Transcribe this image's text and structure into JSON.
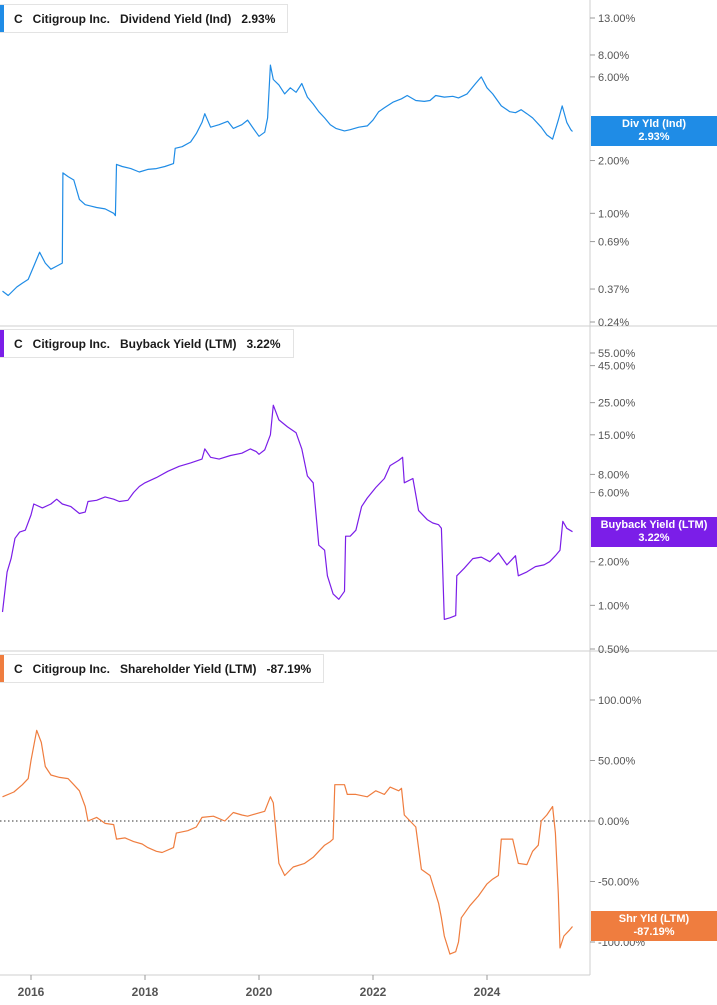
{
  "chart_data": [
    {
      "type": "line",
      "ticker": "C",
      "company": "Citigroup Inc.",
      "metric": "Dividend Yield (Ind)",
      "current_value": "2.93%",
      "flag_label": "Div Yld (Ind)",
      "color": "#1f8ce6",
      "y_scale": "log",
      "ylim": [
        0.24,
        15.0
      ],
      "y_ticks": [
        {
          "v": 13.0,
          "label": "13.00%"
        },
        {
          "v": 8.0,
          "label": "8.00%"
        },
        {
          "v": 6.0,
          "label": "6.00%"
        },
        {
          "v": 2.0,
          "label": "2.00%"
        },
        {
          "v": 1.0,
          "label": "1.00%"
        },
        {
          "v": 0.69,
          "label": "0.69%"
        },
        {
          "v": 0.37,
          "label": "0.37%"
        },
        {
          "v": 0.24,
          "label": "0.24%"
        }
      ],
      "points": [
        [
          2015.5,
          0.36
        ],
        [
          2015.6,
          0.34
        ],
        [
          2015.75,
          0.38
        ],
        [
          2015.85,
          0.4
        ],
        [
          2015.95,
          0.42
        ],
        [
          2016.05,
          0.5
        ],
        [
          2016.15,
          0.6
        ],
        [
          2016.25,
          0.52
        ],
        [
          2016.35,
          0.48
        ],
        [
          2016.45,
          0.5
        ],
        [
          2016.55,
          0.52
        ],
        [
          2016.56,
          1.7
        ],
        [
          2016.65,
          1.62
        ],
        [
          2016.75,
          1.55
        ],
        [
          2016.85,
          1.2
        ],
        [
          2016.95,
          1.12
        ],
        [
          2017.05,
          1.1
        ],
        [
          2017.15,
          1.08
        ],
        [
          2017.3,
          1.06
        ],
        [
          2017.45,
          1.0
        ],
        [
          2017.48,
          0.97
        ],
        [
          2017.5,
          1.9
        ],
        [
          2017.6,
          1.85
        ],
        [
          2017.75,
          1.8
        ],
        [
          2017.9,
          1.72
        ],
        [
          2018.05,
          1.78
        ],
        [
          2018.2,
          1.8
        ],
        [
          2018.35,
          1.85
        ],
        [
          2018.5,
          1.92
        ],
        [
          2018.53,
          2.35
        ],
        [
          2018.65,
          2.4
        ],
        [
          2018.8,
          2.55
        ],
        [
          2018.9,
          2.85
        ],
        [
          2019.0,
          3.3
        ],
        [
          2019.05,
          3.7
        ],
        [
          2019.15,
          3.1
        ],
        [
          2019.3,
          3.2
        ],
        [
          2019.45,
          3.35
        ],
        [
          2019.55,
          3.05
        ],
        [
          2019.7,
          3.2
        ],
        [
          2019.8,
          3.4
        ],
        [
          2019.9,
          3.05
        ],
        [
          2020.0,
          2.75
        ],
        [
          2020.1,
          2.9
        ],
        [
          2020.15,
          3.5
        ],
        [
          2020.2,
          7.0
        ],
        [
          2020.25,
          5.8
        ],
        [
          2020.35,
          5.4
        ],
        [
          2020.45,
          4.8
        ],
        [
          2020.55,
          5.2
        ],
        [
          2020.65,
          4.9
        ],
        [
          2020.75,
          5.5
        ],
        [
          2020.85,
          4.6
        ],
        [
          2020.95,
          4.2
        ],
        [
          2021.05,
          3.8
        ],
        [
          2021.15,
          3.5
        ],
        [
          2021.25,
          3.2
        ],
        [
          2021.35,
          3.05
        ],
        [
          2021.5,
          2.95
        ],
        [
          2021.6,
          3.0
        ],
        [
          2021.75,
          3.1
        ],
        [
          2021.9,
          3.15
        ],
        [
          2022.0,
          3.4
        ],
        [
          2022.1,
          3.8
        ],
        [
          2022.2,
          4.0
        ],
        [
          2022.35,
          4.3
        ],
        [
          2022.5,
          4.5
        ],
        [
          2022.6,
          4.7
        ],
        [
          2022.75,
          4.4
        ],
        [
          2022.9,
          4.35
        ],
        [
          2023.0,
          4.4
        ],
        [
          2023.1,
          4.7
        ],
        [
          2023.25,
          4.6
        ],
        [
          2023.4,
          4.65
        ],
        [
          2023.5,
          4.55
        ],
        [
          2023.65,
          4.8
        ],
        [
          2023.8,
          5.5
        ],
        [
          2023.9,
          6.0
        ],
        [
          2024.0,
          5.2
        ],
        [
          2024.1,
          4.8
        ],
        [
          2024.25,
          4.1
        ],
        [
          2024.4,
          3.8
        ],
        [
          2024.5,
          3.75
        ],
        [
          2024.6,
          3.9
        ],
        [
          2024.7,
          3.7
        ],
        [
          2024.8,
          3.5
        ],
        [
          2024.95,
          3.1
        ],
        [
          2025.05,
          2.8
        ],
        [
          2025.15,
          2.65
        ],
        [
          2025.25,
          3.4
        ],
        [
          2025.32,
          4.1
        ],
        [
          2025.4,
          3.3
        ],
        [
          2025.47,
          3.0
        ],
        [
          2025.5,
          2.93
        ]
      ]
    },
    {
      "type": "line",
      "ticker": "C",
      "company": "Citigroup Inc.",
      "metric": "Buyback Yield (LTM)",
      "current_value": "3.22%",
      "flag_label": "Buyback Yield (LTM)",
      "color": "#7b1ee8",
      "y_scale": "log",
      "ylim": [
        0.5,
        70.0
      ],
      "y_ticks": [
        {
          "v": 55.0,
          "label": "55.00%"
        },
        {
          "v": 45.0,
          "label": "45.00%"
        },
        {
          "v": 25.0,
          "label": "25.00%"
        },
        {
          "v": 15.0,
          "label": "15.00%"
        },
        {
          "v": 8.0,
          "label": "8.00%"
        },
        {
          "v": 6.0,
          "label": "6.00%"
        },
        {
          "v": 2.0,
          "label": "2.00%"
        },
        {
          "v": 1.0,
          "label": "1.00%"
        },
        {
          "v": 0.5,
          "label": "0.50%"
        }
      ],
      "points": [
        [
          2015.5,
          0.9
        ],
        [
          2015.58,
          1.7
        ],
        [
          2015.65,
          2.1
        ],
        [
          2015.72,
          2.9
        ],
        [
          2015.8,
          3.2
        ],
        [
          2015.9,
          3.3
        ],
        [
          2016.0,
          4.2
        ],
        [
          2016.05,
          5.0
        ],
        [
          2016.2,
          4.7
        ],
        [
          2016.35,
          5.0
        ],
        [
          2016.45,
          5.4
        ],
        [
          2016.55,
          5.0
        ],
        [
          2016.7,
          4.8
        ],
        [
          2016.85,
          4.3
        ],
        [
          2016.95,
          4.4
        ],
        [
          2017.0,
          5.2
        ],
        [
          2017.15,
          5.3
        ],
        [
          2017.3,
          5.6
        ],
        [
          2017.45,
          5.4
        ],
        [
          2017.55,
          5.2
        ],
        [
          2017.7,
          5.3
        ],
        [
          2017.8,
          6.0
        ],
        [
          2017.9,
          6.6
        ],
        [
          2018.0,
          7.0
        ],
        [
          2018.2,
          7.6
        ],
        [
          2018.4,
          8.4
        ],
        [
          2018.6,
          9.1
        ],
        [
          2018.8,
          9.6
        ],
        [
          2019.0,
          10.2
        ],
        [
          2019.05,
          12.0
        ],
        [
          2019.15,
          10.5
        ],
        [
          2019.3,
          10.2
        ],
        [
          2019.5,
          10.8
        ],
        [
          2019.7,
          11.2
        ],
        [
          2019.85,
          12.0
        ],
        [
          2019.95,
          11.5
        ],
        [
          2020.0,
          11.0
        ],
        [
          2020.1,
          11.8
        ],
        [
          2020.2,
          15.0
        ],
        [
          2020.25,
          24.0
        ],
        [
          2020.35,
          19.0
        ],
        [
          2020.5,
          17.0
        ],
        [
          2020.65,
          15.5
        ],
        [
          2020.75,
          12.0
        ],
        [
          2020.85,
          7.8
        ],
        [
          2020.95,
          7.0
        ],
        [
          2021.05,
          2.6
        ],
        [
          2021.15,
          2.4
        ],
        [
          2021.2,
          1.6
        ],
        [
          2021.3,
          1.2
        ],
        [
          2021.4,
          1.1
        ],
        [
          2021.5,
          1.25
        ],
        [
          2021.52,
          3.0
        ],
        [
          2021.6,
          3.0
        ],
        [
          2021.7,
          3.3
        ],
        [
          2021.8,
          4.8
        ],
        [
          2021.9,
          5.5
        ],
        [
          2022.05,
          6.5
        ],
        [
          2022.2,
          7.5
        ],
        [
          2022.3,
          9.2
        ],
        [
          2022.45,
          10.0
        ],
        [
          2022.52,
          10.5
        ],
        [
          2022.55,
          7.0
        ],
        [
          2022.7,
          7.5
        ],
        [
          2022.8,
          4.5
        ],
        [
          2022.95,
          3.9
        ],
        [
          2023.05,
          3.7
        ],
        [
          2023.15,
          3.6
        ],
        [
          2023.2,
          3.4
        ],
        [
          2023.25,
          0.8
        ],
        [
          2023.35,
          0.82
        ],
        [
          2023.45,
          0.85
        ],
        [
          2023.47,
          1.6
        ],
        [
          2023.6,
          1.8
        ],
        [
          2023.75,
          2.1
        ],
        [
          2023.9,
          2.15
        ],
        [
          2024.05,
          2.0
        ],
        [
          2024.2,
          2.3
        ],
        [
          2024.35,
          1.9
        ],
        [
          2024.5,
          2.2
        ],
        [
          2024.55,
          1.6
        ],
        [
          2024.7,
          1.7
        ],
        [
          2024.85,
          1.85
        ],
        [
          2025.0,
          1.9
        ],
        [
          2025.1,
          2.0
        ],
        [
          2025.2,
          2.2
        ],
        [
          2025.28,
          2.4
        ],
        [
          2025.33,
          3.8
        ],
        [
          2025.4,
          3.4
        ],
        [
          2025.5,
          3.22
        ]
      ]
    },
    {
      "type": "line",
      "ticker": "C",
      "company": "Citigroup Inc.",
      "metric": "Shareholder Yield (LTM)",
      "current_value": "-87.19%",
      "flag_label": "Shr Yld (LTM)",
      "color": "#ef7d3f",
      "y_scale": "linear",
      "ylim": [
        -135.0,
        145.0
      ],
      "zero_line": true,
      "y_ticks": [
        {
          "v": 100.0,
          "label": "100.00%"
        },
        {
          "v": 50.0,
          "label": "50.00%"
        },
        {
          "v": 0.0,
          "label": "0.00%"
        },
        {
          "v": -50.0,
          "label": "-50.00%"
        },
        {
          "v": -100.0,
          "label": "-100.00%"
        }
      ],
      "points": [
        [
          2015.5,
          20
        ],
        [
          2015.7,
          24
        ],
        [
          2015.85,
          30
        ],
        [
          2015.95,
          35
        ],
        [
          2016.0,
          50
        ],
        [
          2016.1,
          75
        ],
        [
          2016.18,
          65
        ],
        [
          2016.25,
          45
        ],
        [
          2016.35,
          38
        ],
        [
          2016.5,
          36
        ],
        [
          2016.65,
          35
        ],
        [
          2016.75,
          30
        ],
        [
          2016.85,
          25
        ],
        [
          2016.95,
          12
        ],
        [
          2017.0,
          0
        ],
        [
          2017.15,
          3
        ],
        [
          2017.3,
          -2
        ],
        [
          2017.45,
          -3
        ],
        [
          2017.5,
          -15
        ],
        [
          2017.65,
          -14
        ],
        [
          2017.8,
          -17
        ],
        [
          2017.95,
          -19
        ],
        [
          2018.05,
          -22
        ],
        [
          2018.2,
          -25
        ],
        [
          2018.3,
          -26
        ],
        [
          2018.5,
          -22
        ],
        [
          2018.55,
          -10
        ],
        [
          2018.75,
          -8
        ],
        [
          2018.9,
          -5
        ],
        [
          2019.0,
          3
        ],
        [
          2019.2,
          4
        ],
        [
          2019.4,
          0
        ],
        [
          2019.55,
          7
        ],
        [
          2019.7,
          5
        ],
        [
          2019.8,
          4
        ],
        [
          2019.95,
          6
        ],
        [
          2020.1,
          8
        ],
        [
          2020.2,
          20
        ],
        [
          2020.25,
          15
        ],
        [
          2020.35,
          -35
        ],
        [
          2020.45,
          -45
        ],
        [
          2020.6,
          -38
        ],
        [
          2020.8,
          -35
        ],
        [
          2020.95,
          -30
        ],
        [
          2021.05,
          -25
        ],
        [
          2021.15,
          -20
        ],
        [
          2021.25,
          -17
        ],
        [
          2021.3,
          -15
        ],
        [
          2021.33,
          30
        ],
        [
          2021.5,
          30
        ],
        [
          2021.55,
          22
        ],
        [
          2021.7,
          22
        ],
        [
          2021.9,
          20
        ],
        [
          2022.05,
          25
        ],
        [
          2022.2,
          22
        ],
        [
          2022.3,
          28
        ],
        [
          2022.45,
          25
        ],
        [
          2022.5,
          27
        ],
        [
          2022.55,
          5
        ],
        [
          2022.75,
          -5
        ],
        [
          2022.85,
          -40
        ],
        [
          2023.0,
          -45
        ],
        [
          2023.15,
          -68
        ],
        [
          2023.2,
          -80
        ],
        [
          2023.25,
          -95
        ],
        [
          2023.35,
          -110
        ],
        [
          2023.45,
          -108
        ],
        [
          2023.5,
          -100
        ],
        [
          2023.55,
          -80
        ],
        [
          2023.7,
          -70
        ],
        [
          2023.85,
          -62
        ],
        [
          2024.0,
          -52
        ],
        [
          2024.1,
          -48
        ],
        [
          2024.2,
          -45
        ],
        [
          2024.25,
          -15
        ],
        [
          2024.45,
          -15
        ],
        [
          2024.55,
          -35
        ],
        [
          2024.7,
          -36
        ],
        [
          2024.8,
          -25
        ],
        [
          2024.9,
          -20
        ],
        [
          2024.95,
          0
        ],
        [
          2025.05,
          5
        ],
        [
          2025.15,
          12
        ],
        [
          2025.2,
          -10
        ],
        [
          2025.25,
          -60
        ],
        [
          2025.28,
          -105
        ],
        [
          2025.35,
          -95
        ],
        [
          2025.45,
          -90
        ],
        [
          2025.5,
          -87.19
        ]
      ]
    }
  ],
  "x_axis": {
    "ticks": [
      {
        "v": 2016,
        "label": "2016"
      },
      {
        "v": 2018,
        "label": "2018"
      },
      {
        "v": 2020,
        "label": "2020"
      },
      {
        "v": 2022,
        "label": "2022"
      },
      {
        "v": 2024,
        "label": "2024"
      }
    ],
    "range": [
      2015.5,
      2025.8
    ]
  }
}
